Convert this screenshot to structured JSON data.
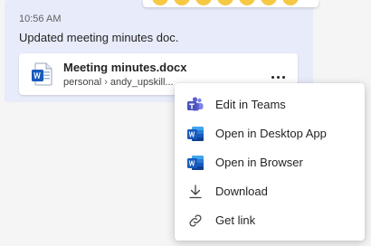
{
  "message": {
    "timestamp": "10:56 AM",
    "text": "Updated meeting minutes doc."
  },
  "file": {
    "name": "Meeting minutes.docx",
    "path_root": "personal",
    "path_sub": "andy_upskill..."
  },
  "context_menu": {
    "items": [
      {
        "label": "Edit in Teams",
        "icon": "teams-icon"
      },
      {
        "label": "Open in Desktop App",
        "icon": "word-icon"
      },
      {
        "label": "Open in Browser",
        "icon": "word-icon"
      },
      {
        "label": "Download",
        "icon": "download-icon"
      },
      {
        "label": "Get link",
        "icon": "link-icon"
      }
    ]
  },
  "colors": {
    "word_blue": "#185abd",
    "teams_purple": "#5b5fc7",
    "message_bg": "#e8ebfa"
  }
}
